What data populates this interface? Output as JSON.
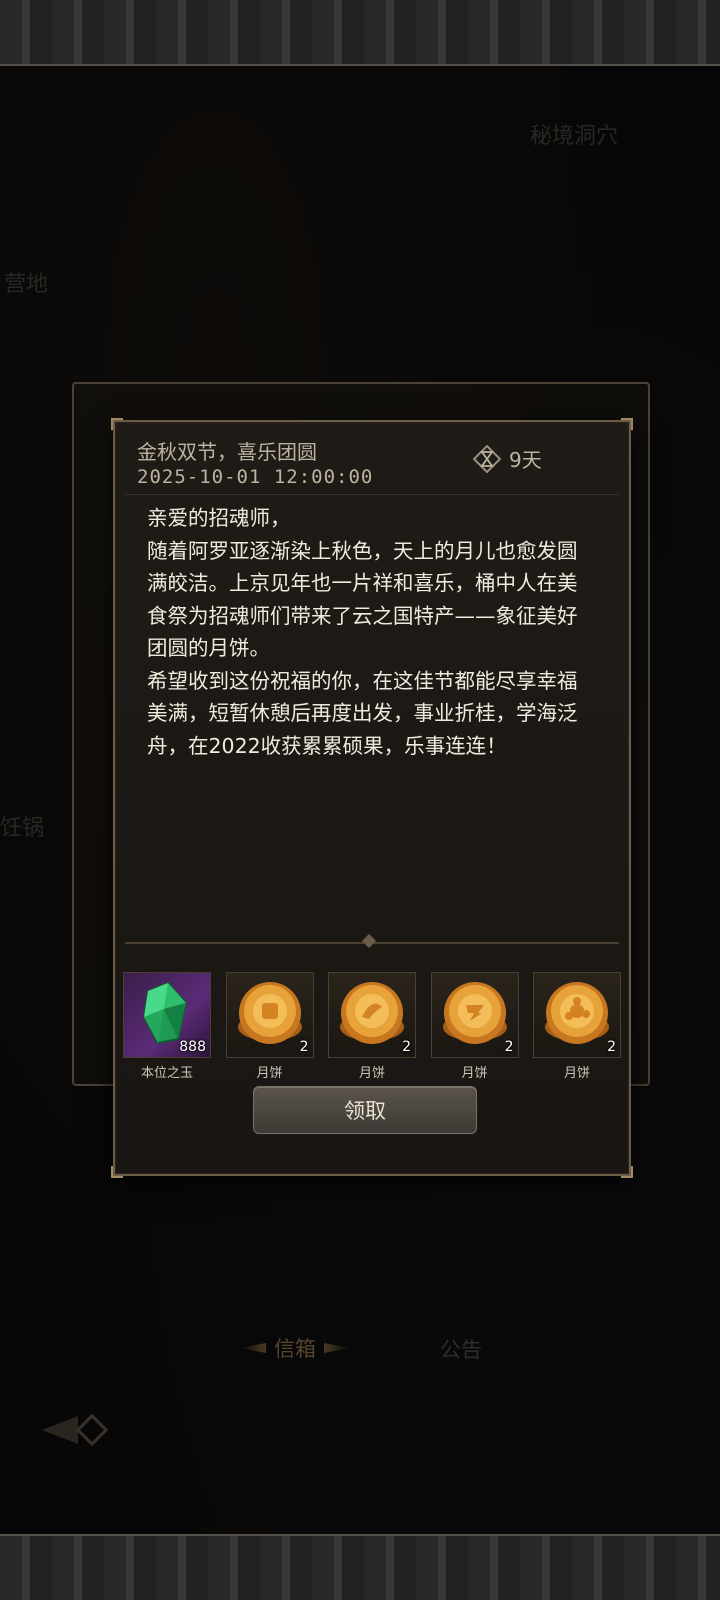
{
  "background": {
    "labels": [
      "秘境洞穴",
      "营地",
      "饪锅"
    ]
  },
  "mail": {
    "title": "金秋双节，喜乐团圆",
    "date": "2025-10-01  12:00:00",
    "expire": "9天",
    "body": "亲爱的招魂师，\n随着阿罗亚逐渐染上秋色，天上的月儿也愈发圆满皎洁。上京见年也一片祥和喜乐，桶中人在美食祭为招魂师们带来了云之国特产——象征美好团圆的月饼。\n希望收到这份祝福的你，在这佳节都能尽享幸福美满，短暂休憩后再度出发，事业折桂，学海泛舟，在2022收获累累硕果，乐事连连！"
  },
  "rewards": [
    {
      "name": "本位之玉",
      "count": "888",
      "icon": "green-gem-icon"
    },
    {
      "name": "月饼",
      "count": "2",
      "icon": "mooncake-icon"
    },
    {
      "name": "月饼",
      "count": "2",
      "icon": "mooncake-icon"
    },
    {
      "name": "月饼",
      "count": "2",
      "icon": "mooncake-icon"
    },
    {
      "name": "月饼",
      "count": "2",
      "icon": "mooncake-icon"
    }
  ],
  "claim_label": "领取",
  "tabs": {
    "mail": "信箱",
    "notice": "公告"
  },
  "colors": {
    "panel_border": "#6a5c46",
    "mooncake": "#e8a23a",
    "gem": "#2fbf6a"
  }
}
